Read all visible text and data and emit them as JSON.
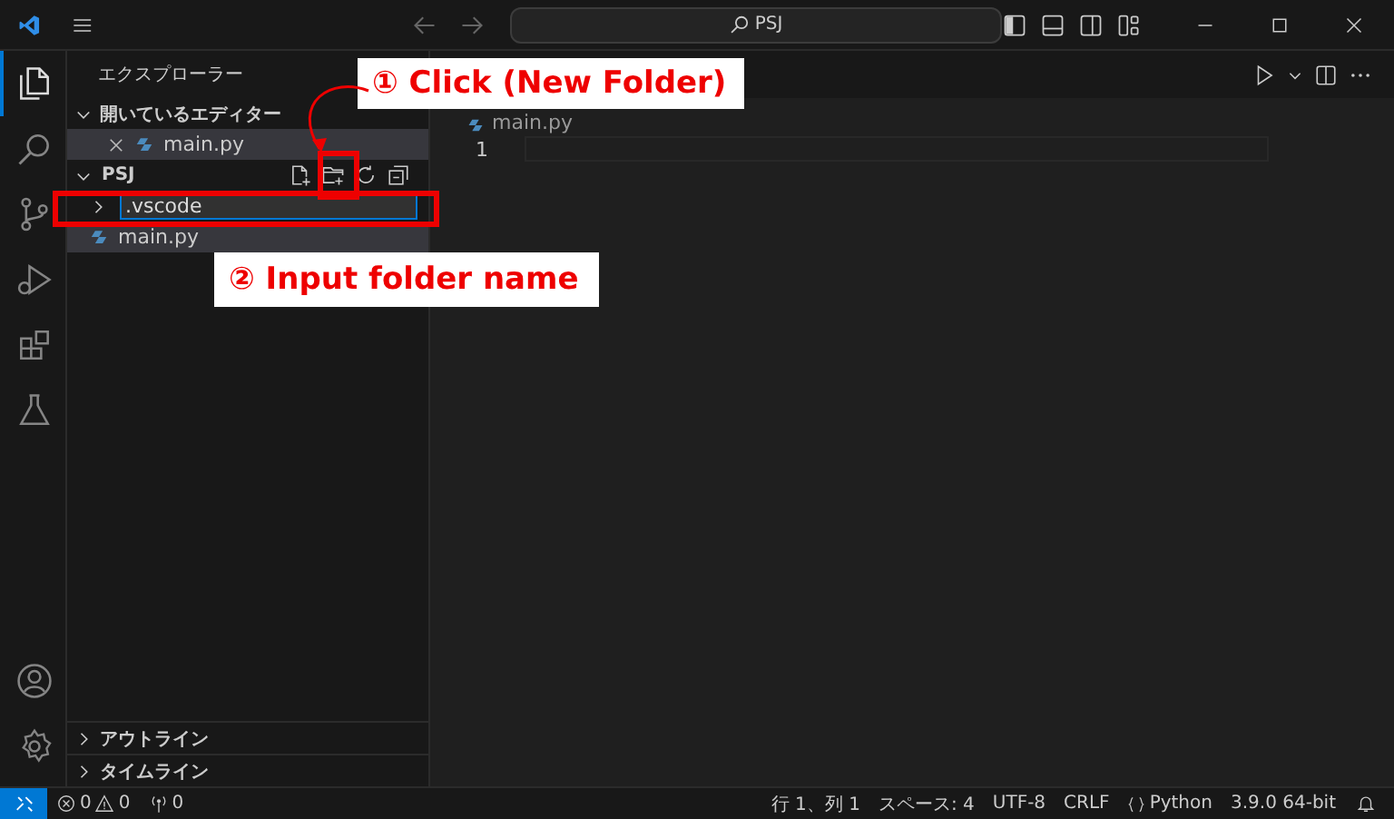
{
  "title_bar": {
    "search": {
      "value": "PSJ"
    }
  },
  "activity_bar": {
    "items": [
      {
        "kind": "explorer",
        "selected": true
      },
      {
        "kind": "search",
        "selected": false
      },
      {
        "kind": "source-control",
        "selected": false
      },
      {
        "kind": "run",
        "selected": false
      },
      {
        "kind": "extensions",
        "selected": false
      },
      {
        "kind": "testing",
        "selected": false
      }
    ],
    "bottom_items": [
      {
        "kind": "account"
      },
      {
        "kind": "settings"
      }
    ]
  },
  "sidebar": {
    "title": "エクスプローラー",
    "open_editors": {
      "label": "開いているエディター",
      "expanded": true,
      "items": [
        {
          "name": "main.py",
          "selected": true
        }
      ]
    },
    "folder": {
      "label": "PSJ",
      "expanded": true,
      "items": [
        {
          "kind": "rename",
          "name": ".vscode",
          "expanded": false
        },
        {
          "kind": "file",
          "name": "main.py",
          "selected": true
        }
      ]
    },
    "bottom_sections": [
      {
        "label": "アウトライン",
        "expanded": false
      },
      {
        "label": "タイムライン",
        "expanded": false
      }
    ]
  },
  "editor": {
    "breadcrumb": "main.py",
    "line_numbers": [
      "1"
    ]
  },
  "status_bar": {
    "errors": "0",
    "warnings": "0",
    "ports": "0",
    "items": [
      {
        "kind": "text",
        "text": "行 1、列 1"
      },
      {
        "kind": "text",
        "text": "スペース: 4"
      },
      {
        "kind": "text",
        "text": "UTF-8"
      },
      {
        "kind": "text",
        "text": "CRLF"
      },
      {
        "kind": "language",
        "text": "Python"
      },
      {
        "kind": "text",
        "text": "3.9.0 64-bit"
      }
    ]
  },
  "annotations": [
    {
      "text": "① Click (New Folder)"
    },
    {
      "text": "② Input folder name"
    }
  ]
}
